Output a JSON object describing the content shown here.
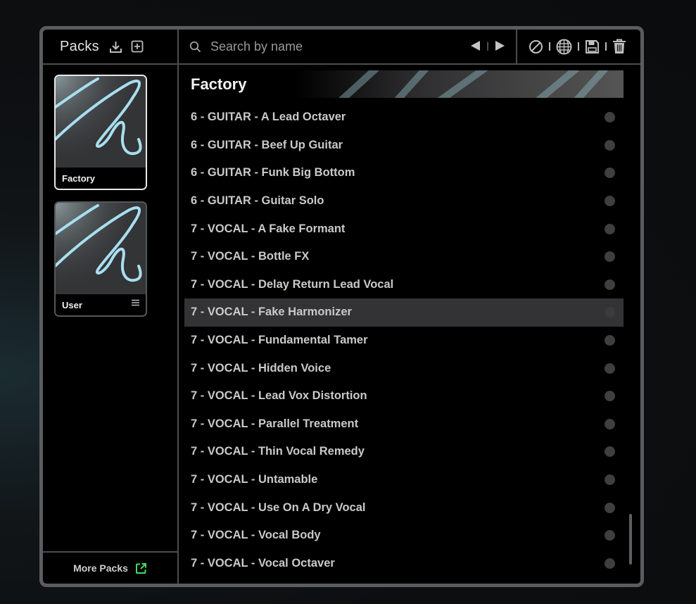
{
  "packs_panel": {
    "title": "Packs",
    "packs": [
      {
        "label": "Factory",
        "selected": true
      },
      {
        "label": "User",
        "selected": false
      }
    ],
    "more_packs_label": "More Packs"
  },
  "search": {
    "placeholder": "Search by name",
    "value": ""
  },
  "banner": {
    "title": "Factory"
  },
  "presets": [
    {
      "label": "6 - GUITAR - A Lead Octaver"
    },
    {
      "label": "6 - GUITAR - Beef Up Guitar"
    },
    {
      "label": "6 - GUITAR - Funk Big Bottom"
    },
    {
      "label": "6 - GUITAR - Guitar Solo"
    },
    {
      "label": "7 - VOCAL - A Fake Formant"
    },
    {
      "label": "7 - VOCAL - Bottle FX"
    },
    {
      "label": "7 - VOCAL - Delay Return Lead Vocal"
    },
    {
      "label": "7 - VOCAL - Fake Harmonizer",
      "highlighted": true
    },
    {
      "label": "7 - VOCAL - Fundamental Tamer"
    },
    {
      "label": "7 - VOCAL - Hidden Voice"
    },
    {
      "label": "7 - VOCAL - Lead Vox Distortion"
    },
    {
      "label": "7 - VOCAL - Parallel Treatment"
    },
    {
      "label": "7 - VOCAL - Thin Vocal Remedy"
    },
    {
      "label": "7 - VOCAL - Untamable"
    },
    {
      "label": "7 - VOCAL - Use On A Dry Vocal"
    },
    {
      "label": "7 - VOCAL - Vocal Body"
    },
    {
      "label": "7 - VOCAL - Vocal Octaver"
    }
  ],
  "colors": {
    "accent_external_link": "#4cd964",
    "artwork_stroke": "#a8dff0",
    "highlight_row": "#333335"
  },
  "icons": [
    "download-icon",
    "add-pack-icon",
    "search-icon",
    "previous-arrow-icon",
    "next-arrow-icon",
    "clear-icon",
    "randomize-icon",
    "save-icon",
    "trash-icon",
    "menu-icon",
    "external-link-icon"
  ]
}
